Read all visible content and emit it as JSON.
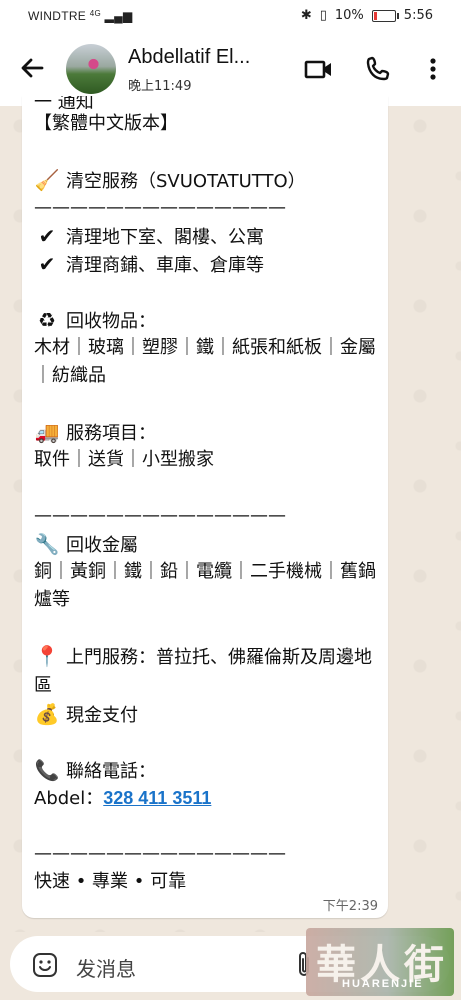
{
  "status_bar": {
    "carrier": "WINDTRE",
    "network": "4G",
    "battery": "10%",
    "time": "5:56"
  },
  "header": {
    "contact_name": "Abdellatif El...",
    "last_seen": "晚上11:49",
    "icons": [
      "back-arrow-icon",
      "video-call-icon",
      "voice-call-icon",
      "more-vert-icon"
    ]
  },
  "message": {
    "cut_top": "一 通知",
    "lines": [
      {
        "text": "【繁體中文版本】"
      },
      {
        "gap": true
      },
      {
        "emoji": "🧹",
        "text": "清空服務（SVUOTATUTTO）"
      },
      {
        "text": "——————————————"
      },
      {
        "emoji": "✔",
        "text": "清理地下室、閣樓、公寓"
      },
      {
        "emoji": "✔",
        "text": "清理商鋪、車庫、倉庫等"
      },
      {
        "gap": true
      },
      {
        "emoji": "♻",
        "text": "回收物品："
      },
      {
        "wrap": true,
        "text": "木材｜玻璃｜塑膠｜鐵｜紙張和紙板｜金屬｜紡織品"
      },
      {
        "gap": true
      },
      {
        "emoji": "🚚",
        "text": "服務項目："
      },
      {
        "text": "取件｜送貨｜小型搬家"
      },
      {
        "gap": true
      },
      {
        "text": "——————————————"
      },
      {
        "emoji": "🔧",
        "text": "回收金屬"
      },
      {
        "wrap": true,
        "text": "銅｜黃銅｜鐵｜鉛｜電纜｜二手機械｜舊鍋爐等"
      },
      {
        "gap": true
      },
      {
        "emoji": "📍",
        "wrap": true,
        "text": "上門服務：普拉托、佛羅倫斯及周邊地區"
      },
      {
        "emoji": "💰",
        "text": "現金支付"
      },
      {
        "gap": true
      },
      {
        "emoji": "📞",
        "text": "聯絡電話："
      },
      {
        "phone_line": true,
        "prefix": "Abdel：",
        "phone": "328 411 3511"
      },
      {
        "gap": true
      },
      {
        "text": "——————————————"
      },
      {
        "text": "快速 • 專業 • 可靠"
      }
    ],
    "time": "下午2:39"
  },
  "input": {
    "placeholder": "发消息"
  },
  "watermark": {
    "big": "華人街",
    "small": "HUARENJIE"
  }
}
